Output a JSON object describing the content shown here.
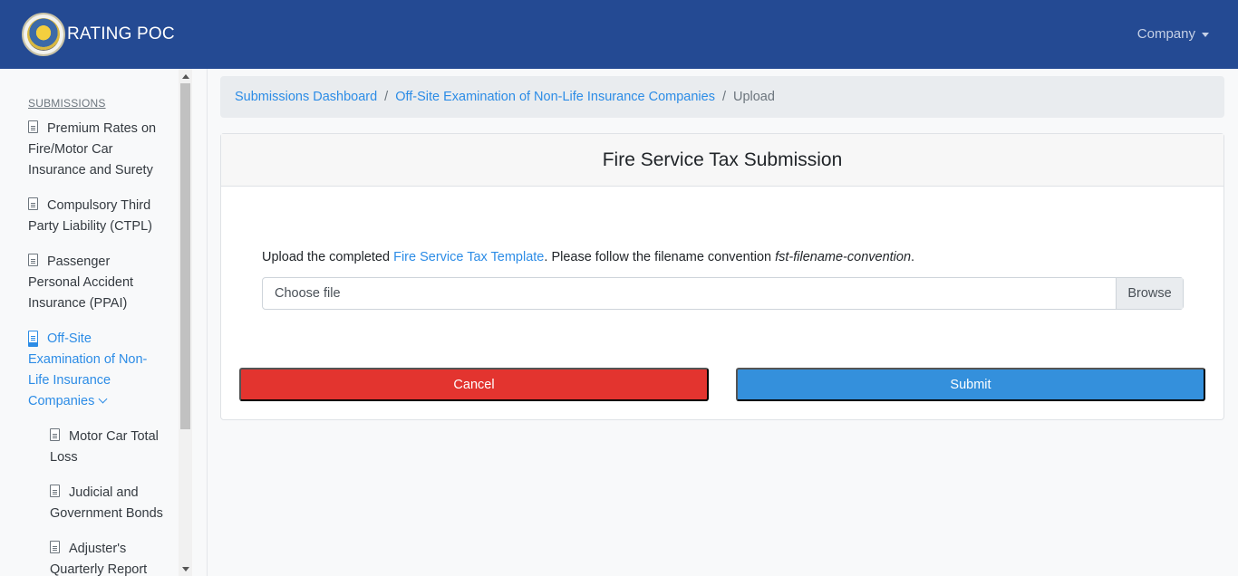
{
  "navbar": {
    "brand": "RATING POC",
    "logo": "insurance-commission-seal-logo",
    "company": "Company"
  },
  "sidebar": {
    "heading": "SUBMISSIONS",
    "items": [
      {
        "label": "Premium Rates on Fire/Motor Car Insurance and Surety",
        "icon": "document-icon",
        "active": false
      },
      {
        "label": "Compulsory Third Party Liability (CTPL)",
        "icon": "document-icon",
        "active": false
      },
      {
        "label": "Passenger Personal Accident Insurance (PPAI)",
        "icon": "document-icon",
        "active": false
      },
      {
        "label": "Off-Site Examination of Non-Life Insurance Companies",
        "icon": "document-icon",
        "active": true,
        "expanded": true
      },
      {
        "label": "Motor Car Total Loss",
        "icon": "document-icon",
        "active": false,
        "child": true
      },
      {
        "label": "Judicial and Government Bonds",
        "icon": "document-icon",
        "active": false,
        "child": true
      },
      {
        "label": "Adjuster's Quarterly Report",
        "icon": "document-icon",
        "active": false,
        "child": true
      }
    ]
  },
  "breadcrumb": {
    "items": [
      "Submissions Dashboard",
      "Off-Site Examination of Non-Life Insurance Companies",
      "Upload"
    ],
    "separator": "/"
  },
  "card": {
    "title": "Fire Service Tax Submission",
    "instruction": {
      "prefix": "Upload the completed ",
      "link": "Fire Service Tax Template",
      "middle": ". Please follow the filename convention ",
      "convention": "fst-filename-convention",
      "suffix": "."
    },
    "file_input": {
      "placeholder": "Choose file",
      "browse_label": "Browse"
    },
    "buttons": {
      "cancel": "Cancel",
      "submit": "Submit"
    }
  },
  "colors": {
    "navbar": "#244a93",
    "link": "#2c8ce6",
    "cancel": "#e3342f",
    "submit": "#3490dc"
  }
}
